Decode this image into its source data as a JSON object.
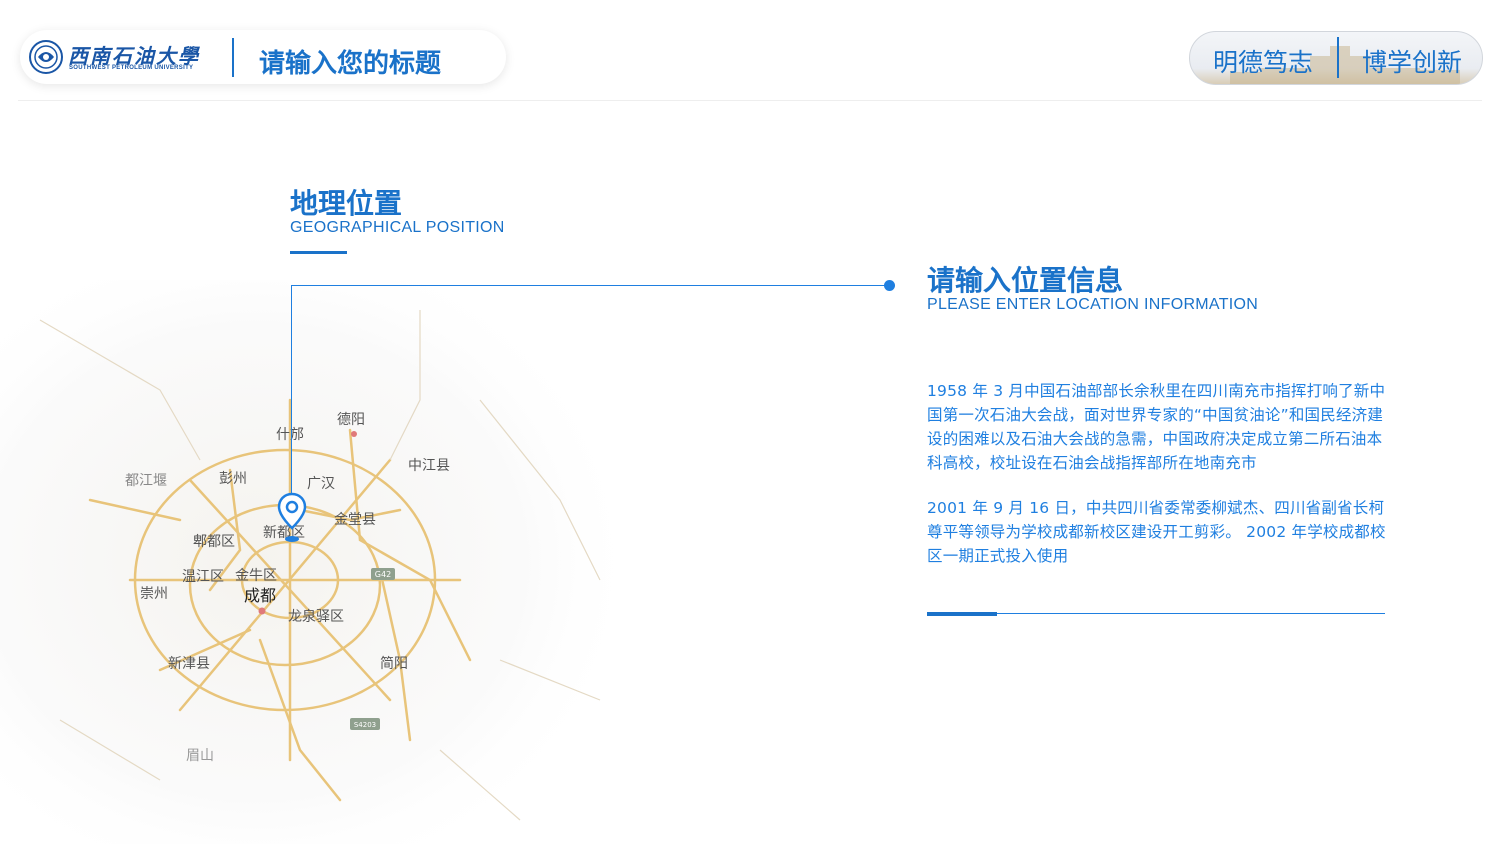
{
  "header": {
    "logo_name": "西南石油大學",
    "logo_sub": "SOUTHWEST PETROLEUM UNIVERSITY",
    "title": "请输入您的标题",
    "motto_left": "明德笃志",
    "motto_right": "博学创新"
  },
  "section": {
    "title": "地理位置",
    "subtitle": "GEOGRAPHICAL POSITION"
  },
  "map": {
    "labels": {
      "deyang": "德阳",
      "shifang": "什邡",
      "zhongjiang": "中江县",
      "dujiangyan": "都江堰",
      "pengzhou": "彭州",
      "guanghan": "广汉",
      "xindu": "新都区",
      "jintang": "金堂县",
      "pixian": "郫都区",
      "wenjiang": "温江区",
      "jinniu": "金牛区",
      "chongzhou": "崇州",
      "chengdu": "成都",
      "longquanyi": "龙泉驿区",
      "xinjin": "新津县",
      "jianyang": "简阳",
      "meishan": "眉山"
    },
    "road_g42": "G42",
    "road_s4203": "S4203"
  },
  "info": {
    "title": "请输入位置信息",
    "subtitle": "PLEASE ENTER LOCATION INFORMATION",
    "para1": "1958 年 3 月中国石油部部长余秋里在四川南充市指挥打响了新中国第一次石油大会战，面对世界专家的“中国贫油论”和国民经济建设的困难以及石油大会战的急需，中国政府决定成立第二所石油本科高校，校址设在石油会战指挥部所在地南充市",
    "para2": "2001 年 9 月 16 日，中共四川省委常委柳斌杰、四川省副省长柯尊平等领导为学校成都新校区建设开工剪彩。 2002 年学校成都校区一期正式投入使用"
  },
  "colors": {
    "primary": "#1a72c9",
    "accent": "#1f7fe0",
    "road": "#e8c47a"
  }
}
